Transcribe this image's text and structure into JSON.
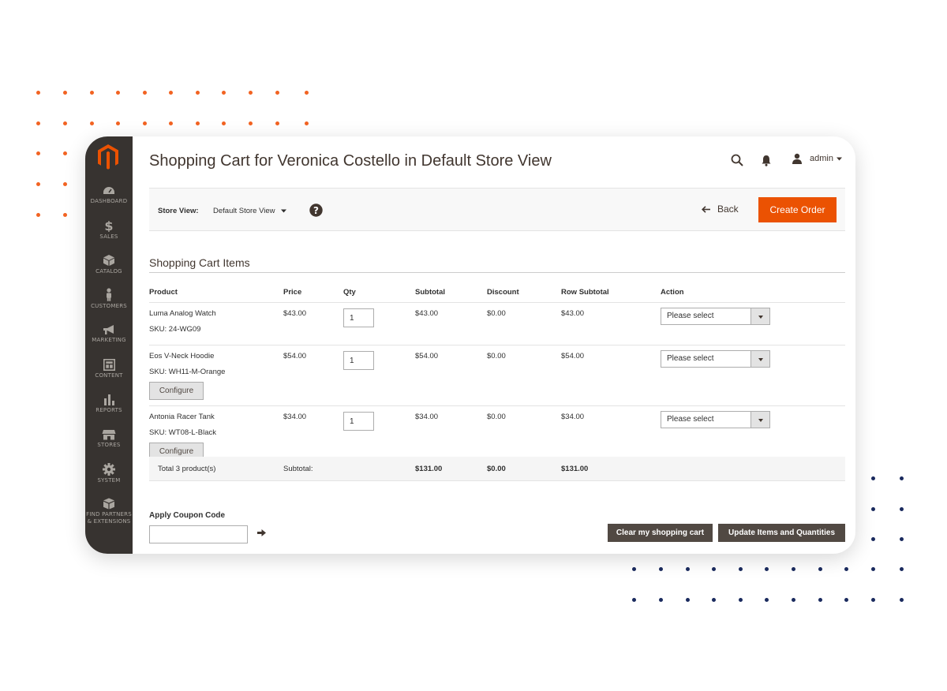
{
  "colors": {
    "accent": "#eb5202",
    "sidebar": "#373330",
    "dots_orange": "#f26322",
    "dots_navy": "#1a2a5e"
  },
  "header": {
    "title": "Shopping Cart for Veronica Costello in Default Store View",
    "user": "admin",
    "icons": [
      "search-icon",
      "bell-icon",
      "user-icon"
    ]
  },
  "sidebar": {
    "items": [
      {
        "label": "DASHBOARD",
        "icon": "gauge-icon"
      },
      {
        "label": "SALES",
        "icon": "dollar-icon"
      },
      {
        "label": "CATALOG",
        "icon": "cube-icon"
      },
      {
        "label": "CUSTOMERS",
        "icon": "person-icon"
      },
      {
        "label": "MARKETING",
        "icon": "megaphone-icon"
      },
      {
        "label": "CONTENT",
        "icon": "layout-icon"
      },
      {
        "label": "REPORTS",
        "icon": "bar-chart-icon"
      },
      {
        "label": "STORES",
        "icon": "storefront-icon"
      },
      {
        "label": "SYSTEM",
        "icon": "gear-icon"
      },
      {
        "label": "FIND PARTNERS & EXTENSIONS",
        "label_line1": "FIND PARTNERS",
        "label_line2": "& EXTENSIONS",
        "icon": "boxes-icon"
      }
    ]
  },
  "toolbar": {
    "store_view_label": "Store View:",
    "store_view_value": "Default Store View",
    "back_label": "Back",
    "create_label": "Create Order"
  },
  "cart": {
    "section_title": "Shopping Cart Items",
    "columns": [
      "Product",
      "Price",
      "Qty",
      "Subtotal",
      "Discount",
      "Row Subtotal",
      "Action"
    ],
    "rows": [
      {
        "name": "Luma Analog Watch",
        "sku": "SKU: 24-WG09",
        "price": "$43.00",
        "qty": "1",
        "subtotal": "$43.00",
        "discount": "$0.00",
        "row_subtotal": "$43.00",
        "action": "Please select"
      },
      {
        "name": "Eos V-Neck Hoodie",
        "sku": "SKU: WH11-M-Orange",
        "price": "$54.00",
        "qty": "1",
        "subtotal": "$54.00",
        "discount": "$0.00",
        "row_subtotal": "$54.00",
        "action": "Please select",
        "configure": "Configure"
      },
      {
        "name": "Antonia Racer Tank",
        "sku": "SKU: WT08-L-Black",
        "price": "$34.00",
        "qty": "1",
        "subtotal": "$34.00",
        "discount": "$0.00",
        "row_subtotal": "$34.00",
        "action": "Please select",
        "configure": "Configure"
      }
    ],
    "totals": {
      "label": "Total 3 product(s)",
      "subtotal_label": "Subtotal:",
      "subtotal": "$131.00",
      "discount": "$0.00",
      "row_subtotal": "$131.00"
    }
  },
  "coupon": {
    "label": "Apply Coupon Code",
    "placeholder": ""
  },
  "actions": {
    "clear_label": "Clear my shopping cart",
    "update_label": "Update Items and Quantities"
  }
}
